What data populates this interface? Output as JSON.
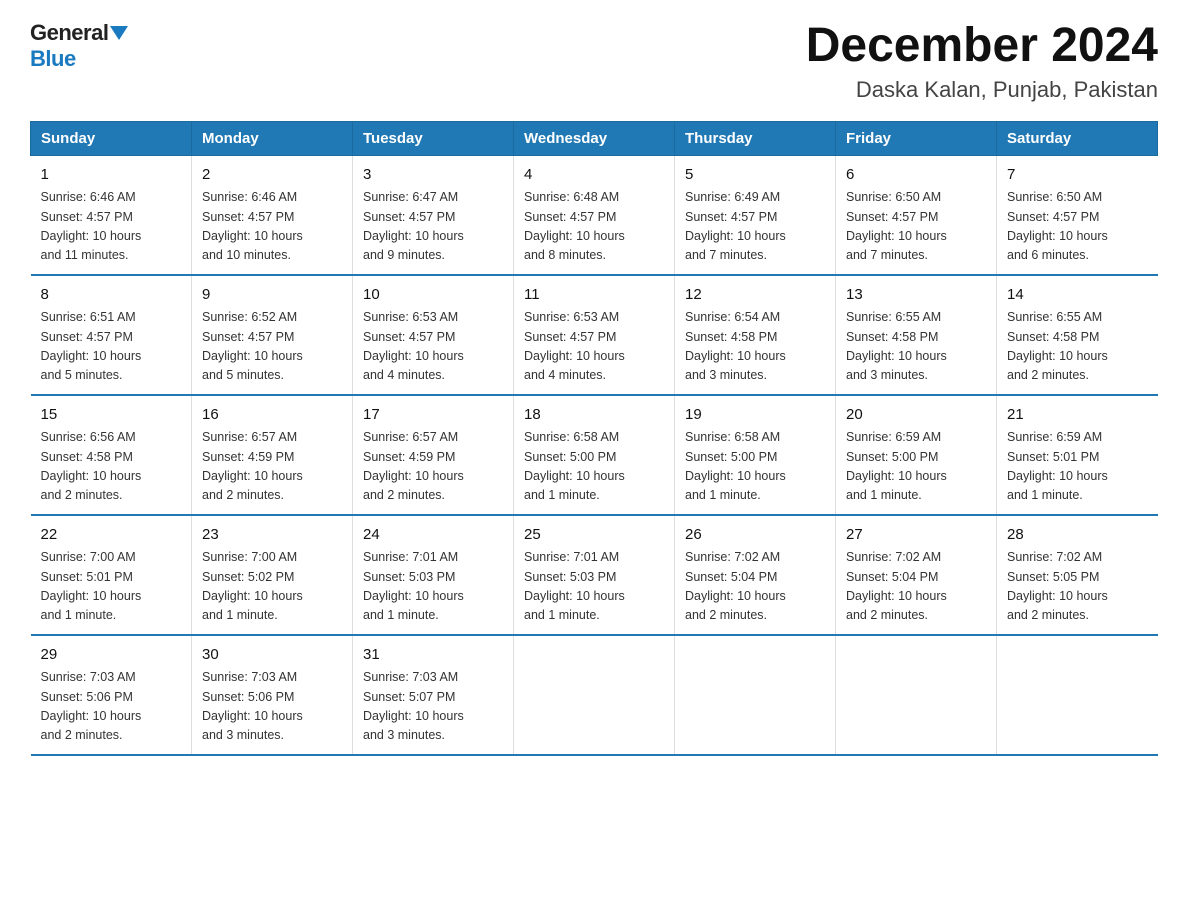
{
  "logo": {
    "general": "General",
    "blue": "Blue"
  },
  "header": {
    "month": "December 2024",
    "location": "Daska Kalan, Punjab, Pakistan"
  },
  "weekdays": [
    "Sunday",
    "Monday",
    "Tuesday",
    "Wednesday",
    "Thursday",
    "Friday",
    "Saturday"
  ],
  "weeks": [
    [
      {
        "day": "1",
        "info": "Sunrise: 6:46 AM\nSunset: 4:57 PM\nDaylight: 10 hours\nand 11 minutes."
      },
      {
        "day": "2",
        "info": "Sunrise: 6:46 AM\nSunset: 4:57 PM\nDaylight: 10 hours\nand 10 minutes."
      },
      {
        "day": "3",
        "info": "Sunrise: 6:47 AM\nSunset: 4:57 PM\nDaylight: 10 hours\nand 9 minutes."
      },
      {
        "day": "4",
        "info": "Sunrise: 6:48 AM\nSunset: 4:57 PM\nDaylight: 10 hours\nand 8 minutes."
      },
      {
        "day": "5",
        "info": "Sunrise: 6:49 AM\nSunset: 4:57 PM\nDaylight: 10 hours\nand 7 minutes."
      },
      {
        "day": "6",
        "info": "Sunrise: 6:50 AM\nSunset: 4:57 PM\nDaylight: 10 hours\nand 7 minutes."
      },
      {
        "day": "7",
        "info": "Sunrise: 6:50 AM\nSunset: 4:57 PM\nDaylight: 10 hours\nand 6 minutes."
      }
    ],
    [
      {
        "day": "8",
        "info": "Sunrise: 6:51 AM\nSunset: 4:57 PM\nDaylight: 10 hours\nand 5 minutes."
      },
      {
        "day": "9",
        "info": "Sunrise: 6:52 AM\nSunset: 4:57 PM\nDaylight: 10 hours\nand 5 minutes."
      },
      {
        "day": "10",
        "info": "Sunrise: 6:53 AM\nSunset: 4:57 PM\nDaylight: 10 hours\nand 4 minutes."
      },
      {
        "day": "11",
        "info": "Sunrise: 6:53 AM\nSunset: 4:57 PM\nDaylight: 10 hours\nand 4 minutes."
      },
      {
        "day": "12",
        "info": "Sunrise: 6:54 AM\nSunset: 4:58 PM\nDaylight: 10 hours\nand 3 minutes."
      },
      {
        "day": "13",
        "info": "Sunrise: 6:55 AM\nSunset: 4:58 PM\nDaylight: 10 hours\nand 3 minutes."
      },
      {
        "day": "14",
        "info": "Sunrise: 6:55 AM\nSunset: 4:58 PM\nDaylight: 10 hours\nand 2 minutes."
      }
    ],
    [
      {
        "day": "15",
        "info": "Sunrise: 6:56 AM\nSunset: 4:58 PM\nDaylight: 10 hours\nand 2 minutes."
      },
      {
        "day": "16",
        "info": "Sunrise: 6:57 AM\nSunset: 4:59 PM\nDaylight: 10 hours\nand 2 minutes."
      },
      {
        "day": "17",
        "info": "Sunrise: 6:57 AM\nSunset: 4:59 PM\nDaylight: 10 hours\nand 2 minutes."
      },
      {
        "day": "18",
        "info": "Sunrise: 6:58 AM\nSunset: 5:00 PM\nDaylight: 10 hours\nand 1 minute."
      },
      {
        "day": "19",
        "info": "Sunrise: 6:58 AM\nSunset: 5:00 PM\nDaylight: 10 hours\nand 1 minute."
      },
      {
        "day": "20",
        "info": "Sunrise: 6:59 AM\nSunset: 5:00 PM\nDaylight: 10 hours\nand 1 minute."
      },
      {
        "day": "21",
        "info": "Sunrise: 6:59 AM\nSunset: 5:01 PM\nDaylight: 10 hours\nand 1 minute."
      }
    ],
    [
      {
        "day": "22",
        "info": "Sunrise: 7:00 AM\nSunset: 5:01 PM\nDaylight: 10 hours\nand 1 minute."
      },
      {
        "day": "23",
        "info": "Sunrise: 7:00 AM\nSunset: 5:02 PM\nDaylight: 10 hours\nand 1 minute."
      },
      {
        "day": "24",
        "info": "Sunrise: 7:01 AM\nSunset: 5:03 PM\nDaylight: 10 hours\nand 1 minute."
      },
      {
        "day": "25",
        "info": "Sunrise: 7:01 AM\nSunset: 5:03 PM\nDaylight: 10 hours\nand 1 minute."
      },
      {
        "day": "26",
        "info": "Sunrise: 7:02 AM\nSunset: 5:04 PM\nDaylight: 10 hours\nand 2 minutes."
      },
      {
        "day": "27",
        "info": "Sunrise: 7:02 AM\nSunset: 5:04 PM\nDaylight: 10 hours\nand 2 minutes."
      },
      {
        "day": "28",
        "info": "Sunrise: 7:02 AM\nSunset: 5:05 PM\nDaylight: 10 hours\nand 2 minutes."
      }
    ],
    [
      {
        "day": "29",
        "info": "Sunrise: 7:03 AM\nSunset: 5:06 PM\nDaylight: 10 hours\nand 2 minutes."
      },
      {
        "day": "30",
        "info": "Sunrise: 7:03 AM\nSunset: 5:06 PM\nDaylight: 10 hours\nand 3 minutes."
      },
      {
        "day": "31",
        "info": "Sunrise: 7:03 AM\nSunset: 5:07 PM\nDaylight: 10 hours\nand 3 minutes."
      },
      null,
      null,
      null,
      null
    ]
  ]
}
